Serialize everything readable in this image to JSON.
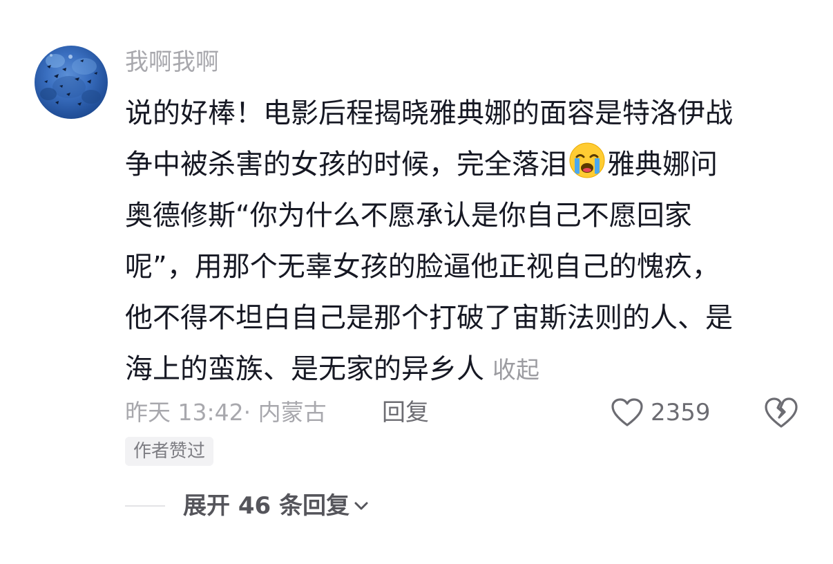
{
  "comment": {
    "username": "我啊我啊",
    "text_lines": [
      "说的好棒！电影后程揭晓雅典娜的面容是特洛伊战",
      "争中被杀害的女孩的时候，完全落泪",
      "雅典娜问",
      "奥德修斯“你为什么不愿承认是你自己不愿回家",
      "呢”，用那个无辜女孩的脸逼他正视自己的愧疚，",
      "他不得不坦白自己是那个打破了宙斯法则的人、是",
      "海上的蛮族、是无家的异乡人"
    ],
    "emoji": "loudly-crying-face",
    "collapse_label": "收起",
    "meta": "昨天 13:42· 内蒙古",
    "reply_label": "回复",
    "like_count": "2359",
    "badge": "作者赞过",
    "expand_label": "展开 46 条回复"
  },
  "colors": {
    "username": "#a8a8ad",
    "text": "#161823",
    "secondary": "#a8a8ad",
    "badge_bg": "#f2f2f4",
    "icon": "#6c6c72"
  }
}
